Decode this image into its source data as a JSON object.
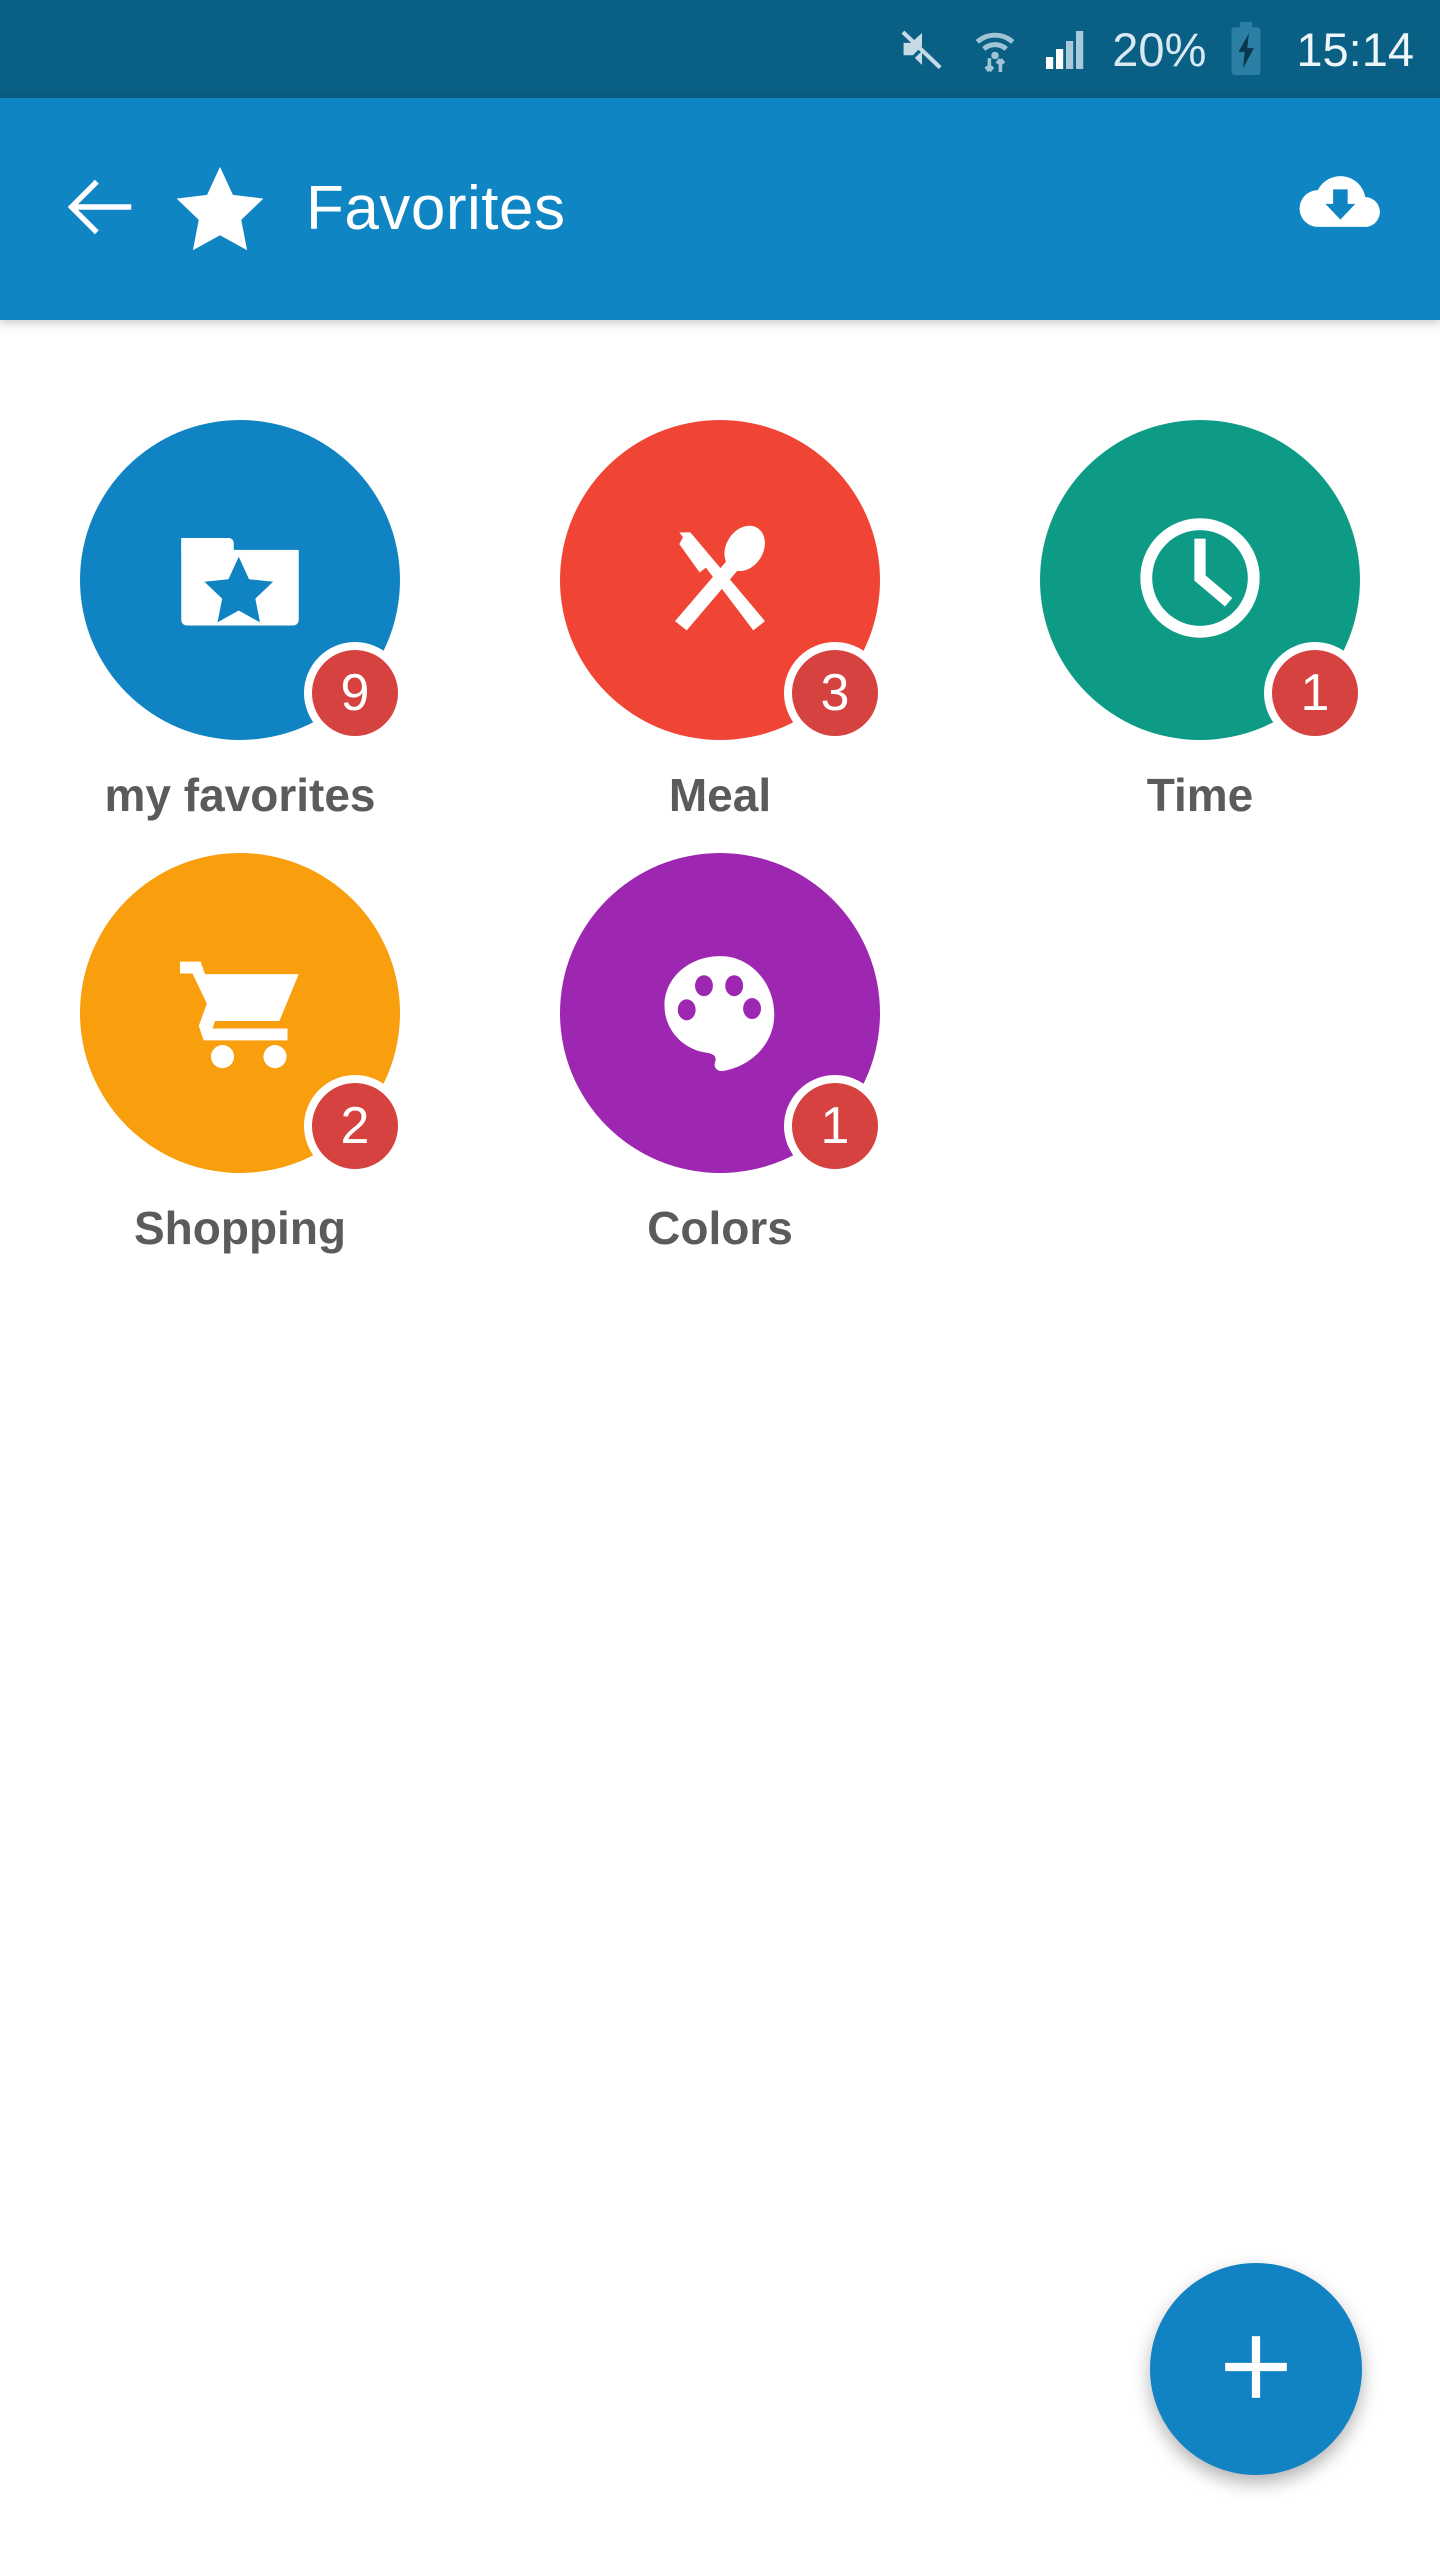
{
  "status_bar": {
    "background": "#0a5f85",
    "mute_icon": "mute-icon",
    "wifi_icon": "wifi-data-transfer-icon",
    "signal_icon": "cellular-signal-icon",
    "battery_percent": "20%",
    "battery_icon": "battery-charging-icon",
    "clock": "15:14"
  },
  "app_bar": {
    "background": "#1085c4",
    "back_icon": "back-arrow-icon",
    "star_icon": "star-icon",
    "title": "Favorites",
    "action_icon": "cloud-download-icon"
  },
  "categories": [
    {
      "label": "my favorites",
      "badge": "9",
      "color": "#1083c2",
      "icon": "folder-star-icon"
    },
    {
      "label": "Meal",
      "badge": "3",
      "color": "#f04434",
      "icon": "cutlery-icon"
    },
    {
      "label": "Time",
      "badge": "1",
      "color": "#0e9b85",
      "icon": "clock-icon"
    },
    {
      "label": "Shopping",
      "badge": "2",
      "color": "#f99e0c",
      "icon": "shopping-cart-icon"
    },
    {
      "label": "Colors",
      "badge": "1",
      "color": "#9d27b0",
      "icon": "palette-icon"
    }
  ],
  "badge_color": "#d6423f",
  "label_color": "#5b5b5b",
  "fab": {
    "icon": "plus-icon",
    "color": "#1183c2"
  }
}
